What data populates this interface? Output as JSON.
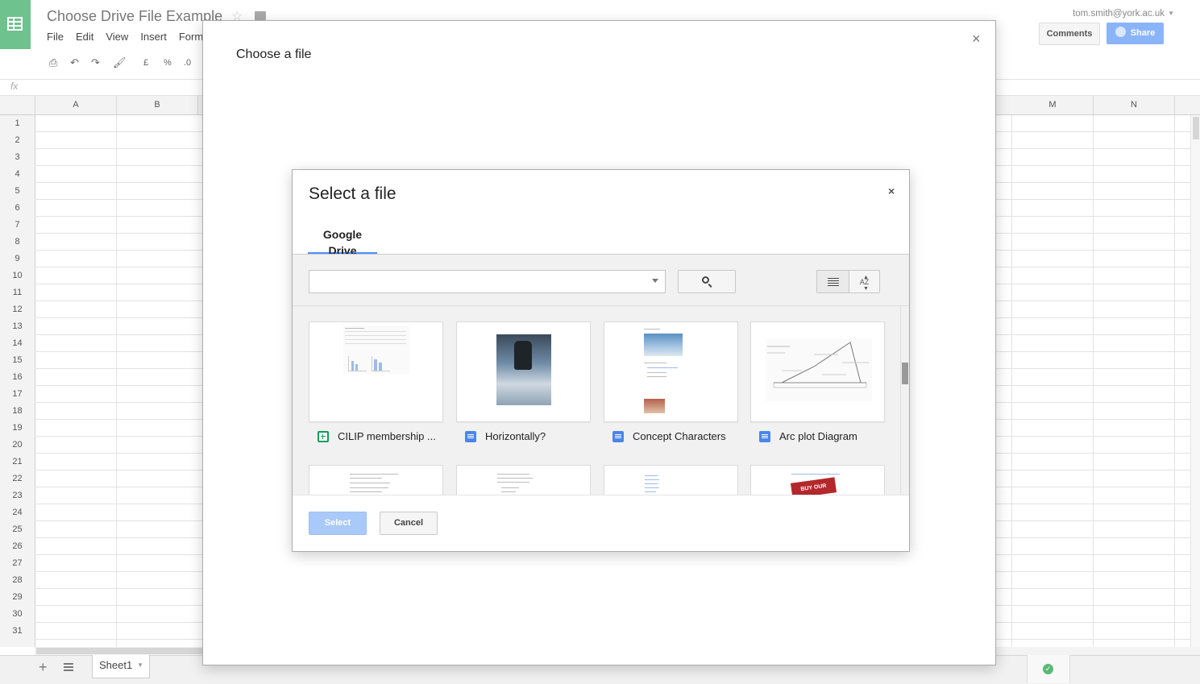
{
  "app": {
    "title": "Choose Drive File Example",
    "menu": [
      "File",
      "Edit",
      "View",
      "Insert",
      "Form"
    ],
    "user_email": "tom.smith@york.ac.uk",
    "comments_label": "Comments",
    "share_label": "Share",
    "toolbar": {
      "currency": "£",
      "percent": "%",
      "decimals": ".0"
    },
    "fx_label": "fx"
  },
  "grid": {
    "columns": [
      "A",
      "B",
      "M",
      "N"
    ],
    "rows": [
      "1",
      "2",
      "3",
      "4",
      "5",
      "6",
      "7",
      "8",
      "9",
      "10",
      "11",
      "12",
      "13",
      "14",
      "15",
      "16",
      "17",
      "18",
      "19",
      "20",
      "21",
      "22",
      "23",
      "24",
      "25",
      "26",
      "27",
      "28",
      "29",
      "30",
      "31"
    ]
  },
  "sheets": {
    "active": "Sheet1"
  },
  "outer_dialog": {
    "title": "Choose a file",
    "close": "×"
  },
  "picker": {
    "title": "Select a file",
    "close": "×",
    "tab": "Google Drive",
    "search_value": "",
    "sort_label": "AZ",
    "files": [
      {
        "name": "CILIP membership ...",
        "type": "spreadsheet"
      },
      {
        "name": "Horizontally?",
        "type": "document"
      },
      {
        "name": "Concept Characters",
        "type": "document"
      },
      {
        "name": "Arc plot Diagram",
        "type": "document"
      }
    ],
    "thumb_text": "BUY OUR PRODUCT",
    "select_label": "Select",
    "cancel_label": "Cancel"
  },
  "colors": {
    "accent": "#4d90fe",
    "sheets_green": "#6ec28d",
    "select_disabled": "#a9c9f8"
  }
}
